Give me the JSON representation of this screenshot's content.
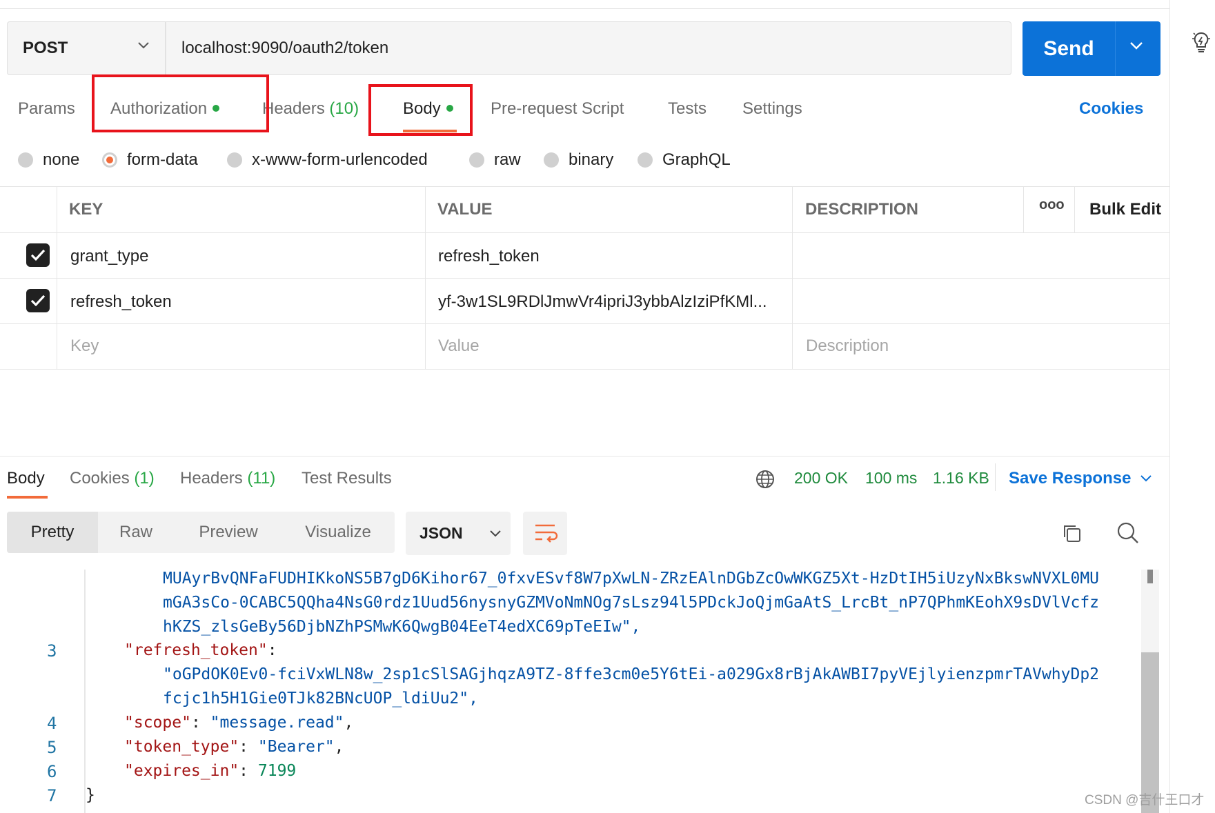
{
  "request": {
    "method": "POST",
    "url": "localhost:9090/oauth2/token",
    "send_label": "Send"
  },
  "request_tabs": [
    {
      "label": "Params",
      "count": "",
      "dot": false
    },
    {
      "label": "Authorization",
      "count": "",
      "dot": true
    },
    {
      "label": "Headers",
      "count": "(10)",
      "dot": false
    },
    {
      "label": "Body",
      "count": "",
      "dot": true,
      "active": true
    },
    {
      "label": "Pre-request Script",
      "count": "",
      "dot": false
    },
    {
      "label": "Tests",
      "count": "",
      "dot": false
    },
    {
      "label": "Settings",
      "count": "",
      "dot": false
    }
  ],
  "cookies_link": "Cookies",
  "body_modes": [
    {
      "label": "none",
      "selected": false
    },
    {
      "label": "form-data",
      "selected": true
    },
    {
      "label": "x-www-form-urlencoded",
      "selected": false
    },
    {
      "label": "raw",
      "selected": false
    },
    {
      "label": "binary",
      "selected": false
    },
    {
      "label": "GraphQL",
      "selected": false
    }
  ],
  "params_table": {
    "headers": {
      "key": "KEY",
      "value": "VALUE",
      "description": "DESCRIPTION",
      "more": "ooo",
      "bulk_edit": "Bulk Edit"
    },
    "rows": [
      {
        "checked": true,
        "key": "grant_type",
        "value": "refresh_token",
        "description": ""
      },
      {
        "checked": true,
        "key": "refresh_token",
        "value": "yf-3w1SL9RDlJmwVr4ipriJ3ybbAlzIziPfKMl...",
        "description": ""
      }
    ],
    "placeholders": {
      "key": "Key",
      "value": "Value",
      "description": "Description"
    }
  },
  "response": {
    "tabs": [
      {
        "label": "Body",
        "count": "",
        "active": true
      },
      {
        "label": "Cookies",
        "count": "(1)"
      },
      {
        "label": "Headers",
        "count": "(11)"
      },
      {
        "label": "Test Results",
        "count": ""
      }
    ],
    "status": "200 OK",
    "time": "100 ms",
    "size": "1.16 KB",
    "save_response": "Save Response",
    "view_modes": [
      "Pretty",
      "Raw",
      "Preview",
      "Visualize"
    ],
    "format": "JSON",
    "code": {
      "wrap_line_1": "MUAyrBvQNFaFUDHIKkoNS5B7gD6Kihor67_0fxvESvf8W7pXwLN-ZRzEAlnDGbZcOwWKGZ5Xt-HzDtIH5iUzyNxBkswNVXL0MU",
      "wrap_line_2": "mGA3sCo-0CABC5QQha4NsG0rdz1Uud56nysnyGZMVoNmNOg7sLsz94l5PDckJoQjmGaAtS_LrcBt_nP7QPhmKEohX9sDVlVcfz",
      "wrap_line_3": "hKZS_zlsGeBy56DjbNZhPSMwK6QwgB04EeT4edXC69pTeEIw\",",
      "line_3_num": "3",
      "line_3_key": "\"refresh_token\"",
      "line_3_colon": ":",
      "line_3_val_1": "\"oGPdOK0Ev0-fciVxWLN8w_2sp1cSlSAGjhqzA9TZ-8ffe3cm0e5Y6tEi-a029Gx8rBjAkAWBI7pyVEjlyienzpmrTAVwhyDp2",
      "line_3_val_2": "fcjc1h5H1Gie0TJk82BNcUOP_ldiUu2\",",
      "line_4_num": "4",
      "line_4_key": "\"scope\"",
      "line_4_colon": ": ",
      "line_4_val": "\"message.read\"",
      "line_4_comma": ",",
      "line_5_num": "5",
      "line_5_key": "\"token_type\"",
      "line_5_colon": ": ",
      "line_5_val": "\"Bearer\"",
      "line_5_comma": ",",
      "line_6_num": "6",
      "line_6_key": "\"expires_in\"",
      "line_6_colon": ": ",
      "line_6_val": "7199",
      "line_7_num": "7",
      "line_7_text": "}"
    }
  },
  "watermark": "CSDN @吉什王口才",
  "colors": {
    "accent": "#0c72d8",
    "active_tab": "#f26b3a",
    "highlight_box": "#e8131b",
    "status_ok": "#1e8a3c"
  }
}
